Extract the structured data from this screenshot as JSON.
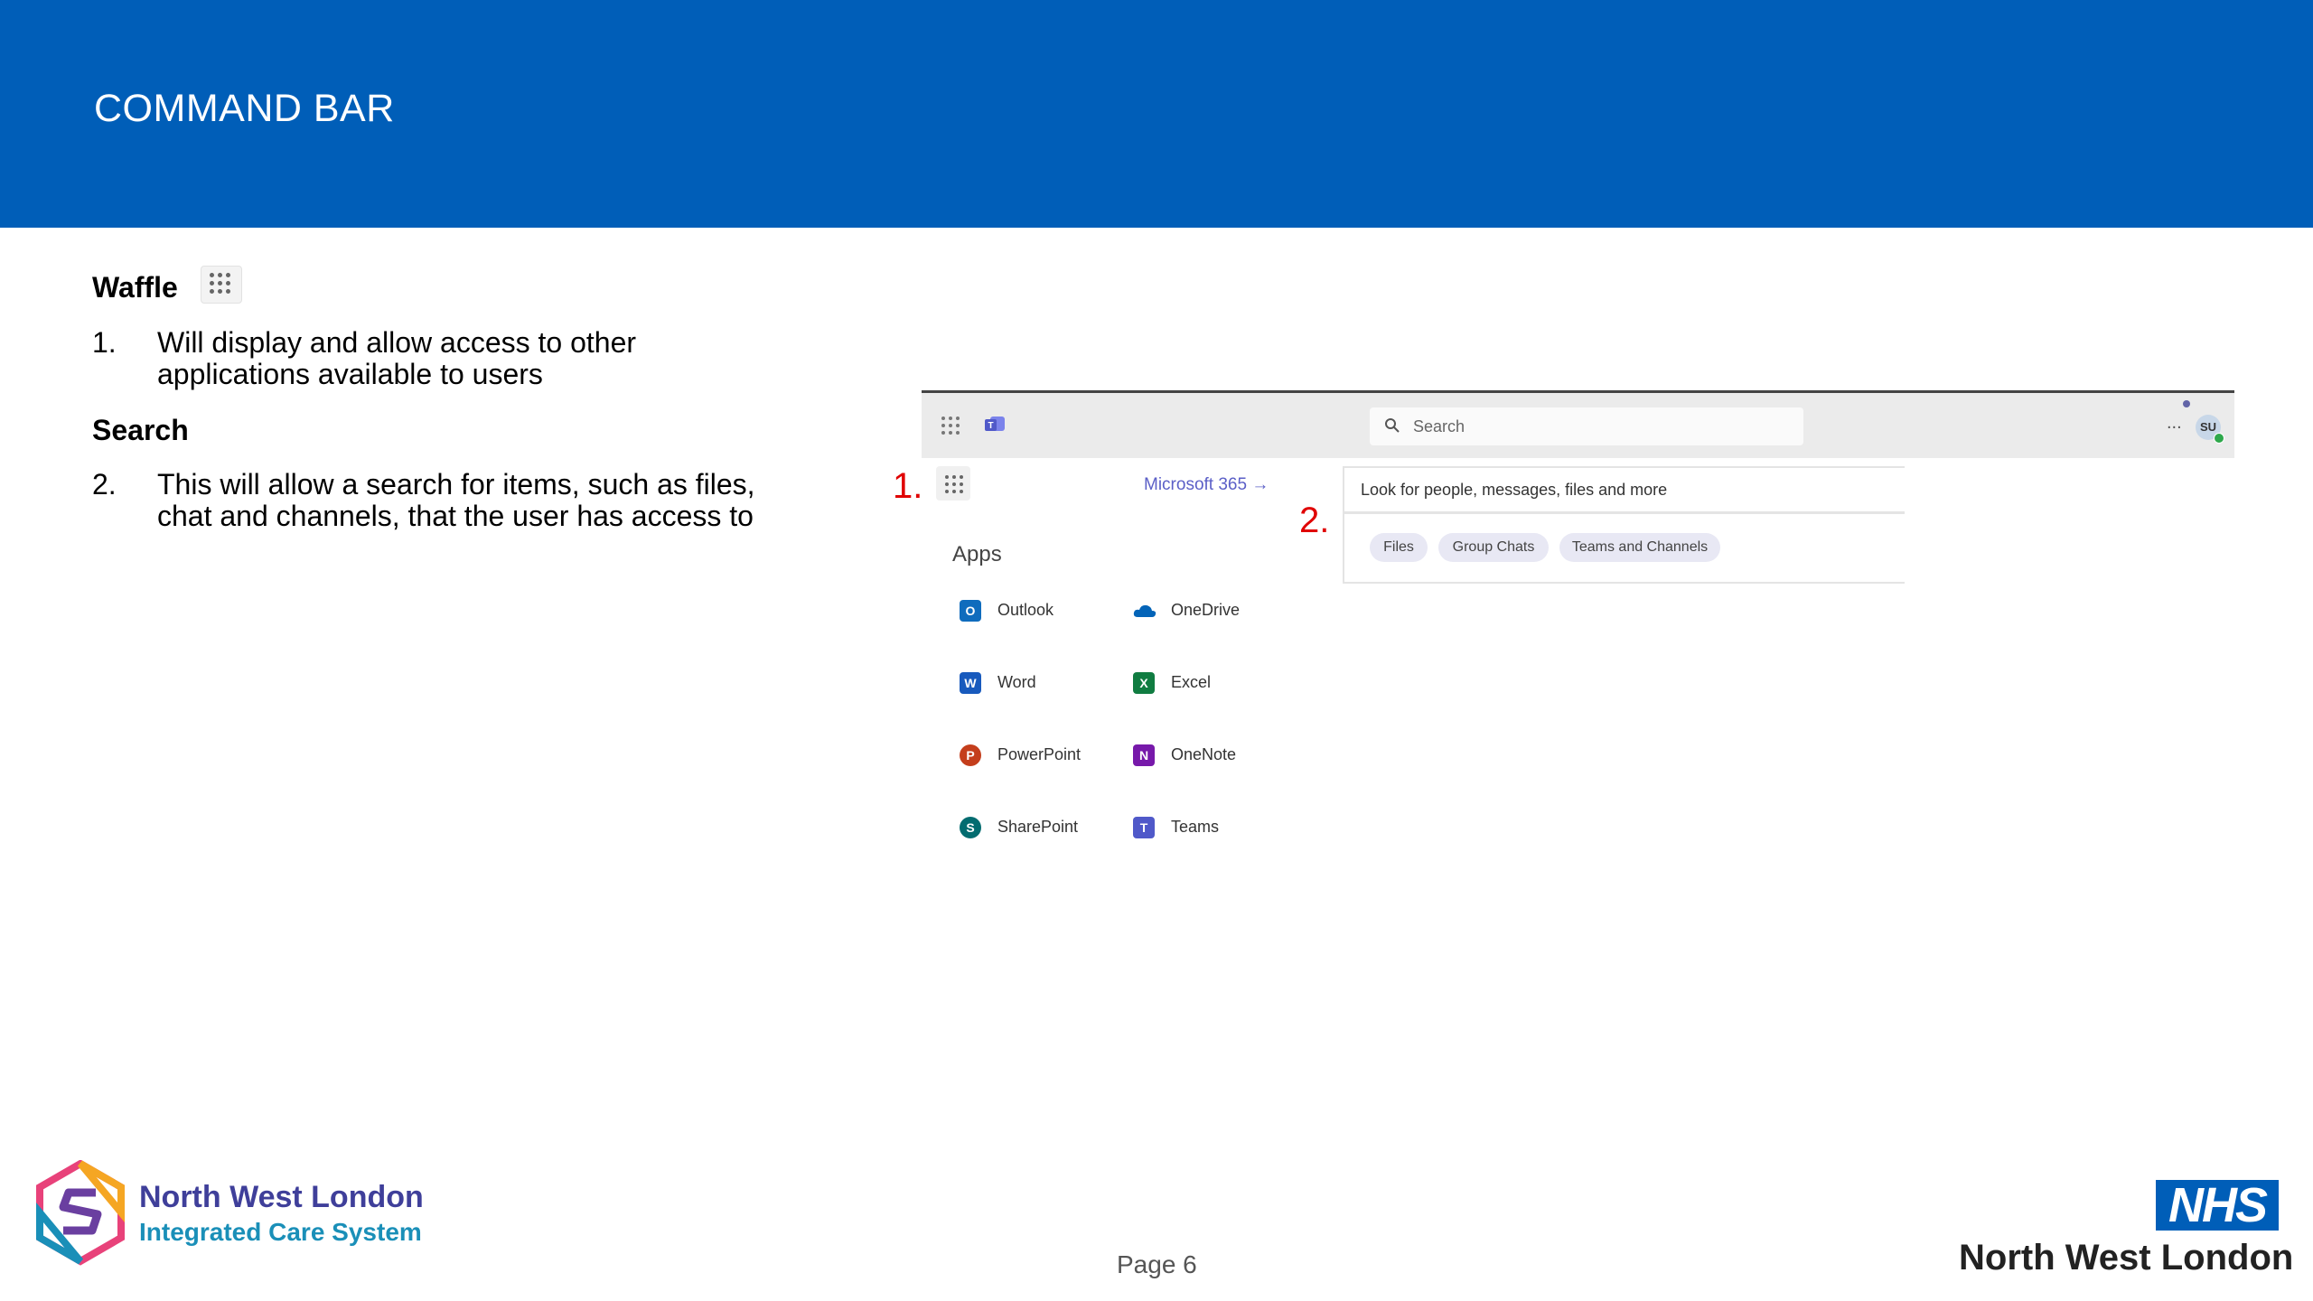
{
  "header": {
    "title": "COMMAND BAR"
  },
  "body": {
    "waffle_heading": "Waffle",
    "item1_num": "1.",
    "item1_text": "Will display and allow access to other applications available to users",
    "search_heading": "Search",
    "item2_num": "2.",
    "item2_text": "This will allow a search for items, such as files, chat and channels, that the user has access to"
  },
  "screenshot": {
    "search_placeholder": "Search",
    "more_label": "...",
    "avatar_initials": "SU",
    "marker1": "1.",
    "marker2": "2.",
    "m365_link": "Microsoft 365  →",
    "apps_title": "Apps",
    "apps": [
      {
        "label": "Outlook",
        "icon": "outlook-icon",
        "color": "#0f6cbd",
        "glyph": "O"
      },
      {
        "label": "OneDrive",
        "icon": "onedrive-icon",
        "color": "#0364b8",
        "glyph": ""
      },
      {
        "label": "Word",
        "icon": "word-icon",
        "color": "#185abd",
        "glyph": "W"
      },
      {
        "label": "Excel",
        "icon": "excel-icon",
        "color": "#107c41",
        "glyph": "X"
      },
      {
        "label": "PowerPoint",
        "icon": "powerpoint-icon",
        "color": "#c43e1c",
        "glyph": "P"
      },
      {
        "label": "OneNote",
        "icon": "onenote-icon",
        "color": "#7719aa",
        "glyph": "N"
      },
      {
        "label": "SharePoint",
        "icon": "sharepoint-icon",
        "color": "#036c70",
        "glyph": "S"
      },
      {
        "label": "Teams",
        "icon": "teams-icon",
        "color": "#5059c9",
        "glyph": "T"
      }
    ],
    "search_panel_text": "Look for people, messages, files and more",
    "chips": [
      "Files",
      "Group Chats",
      "Teams and Channels"
    ]
  },
  "footer": {
    "page": "Page 6",
    "ics_name": "North West London",
    "ics_sub": "Integrated Care System",
    "nhs_logo": "NHS",
    "nhs_region": "North West London"
  },
  "colors": {
    "brand_blue": "#005eb8",
    "marker_red": "#e00000",
    "teams_purple": "#5b5fc7"
  }
}
